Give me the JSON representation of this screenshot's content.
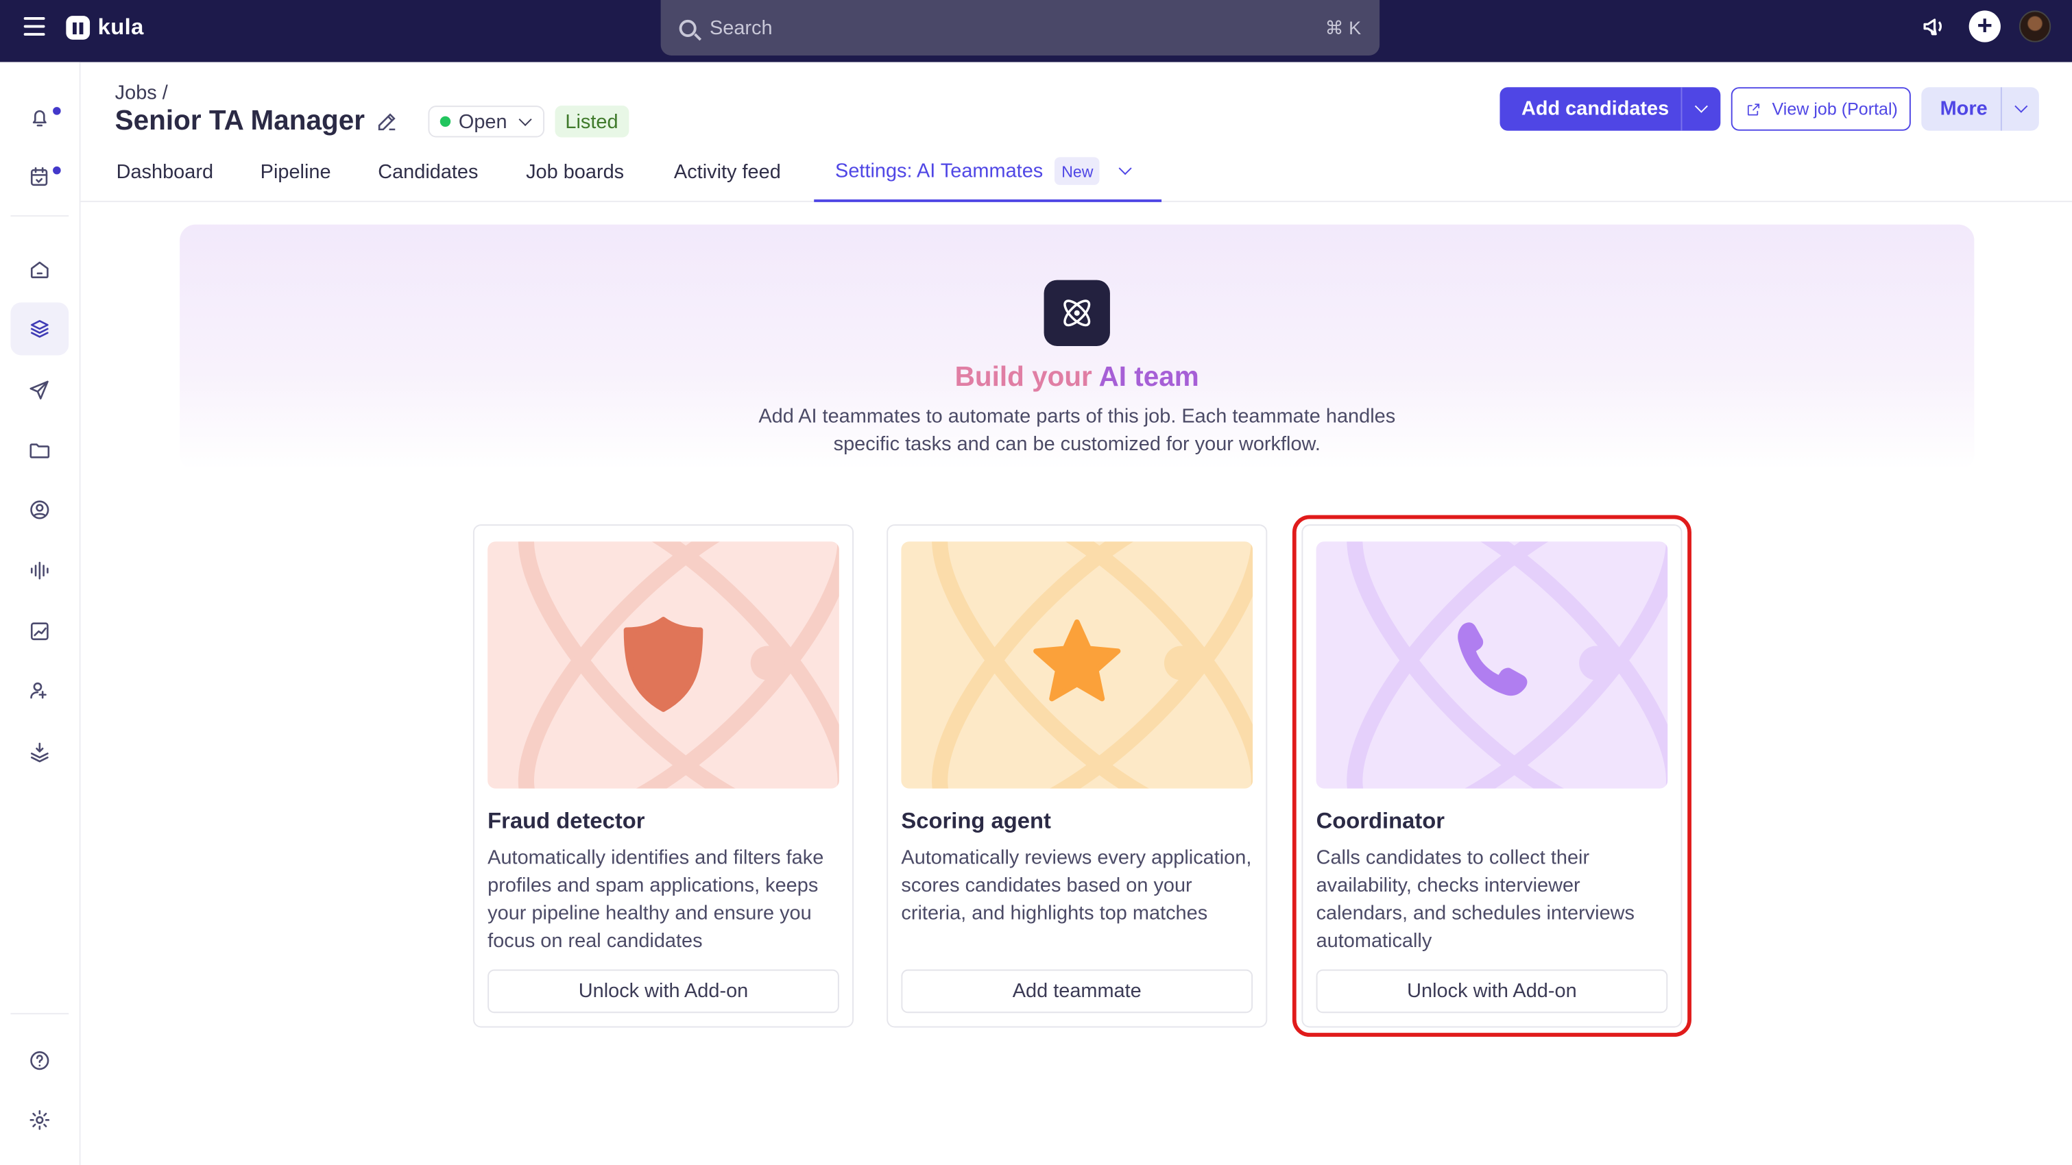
{
  "topbar": {
    "app_name": "kula",
    "search_placeholder": "Search",
    "search_shortcut": "⌘ K"
  },
  "header": {
    "breadcrumb": "Jobs /",
    "title": "Senior TA Manager",
    "status": "Open",
    "listed_badge": "Listed",
    "add_candidates_label": "Add candidates",
    "view_job_label": "View job (Portal)",
    "more_label": "More"
  },
  "tabs": [
    {
      "label": "Dashboard"
    },
    {
      "label": "Pipeline"
    },
    {
      "label": "Candidates"
    },
    {
      "label": "Job boards"
    },
    {
      "label": "Activity feed"
    },
    {
      "label": "Settings: AI Teammates",
      "badge": "New",
      "active": true
    }
  ],
  "hero": {
    "title_part1": "Build your",
    "title_part2": "AI team",
    "description": "Add AI teammates to automate parts of this job. Each teammate handles specific tasks and can be customized for your workflow."
  },
  "cards": [
    {
      "name": "Fraud detector",
      "description": "Automatically identifies and filters fake profiles and spam applications, keeps your pipeline healthy and ensure you focus on real candidates",
      "button": "Unlock with Add-on",
      "icon": "shield-icon",
      "bg_color": "#fde4df",
      "icon_color": "#e07558"
    },
    {
      "name": "Scoring agent",
      "description": "Automatically reviews every application, scores candidates based on your criteria, and highlights top matches",
      "button": "Add teammate",
      "icon": "star-icon",
      "bg_color": "#fde9c7",
      "icon_color": "#fba13a"
    },
    {
      "name": "Coordinator",
      "description": "Calls candidates to collect their availability, checks interviewer calendars, and schedules interviews automatically",
      "button": "Unlock with Add-on",
      "icon": "phone-icon",
      "bg_color": "#f1e4fd",
      "icon_color": "#b07ef0"
    }
  ],
  "colors": {
    "topbar": "#1d1a4b",
    "accent": "#4f46e5",
    "highlight": "#e01b1b"
  }
}
